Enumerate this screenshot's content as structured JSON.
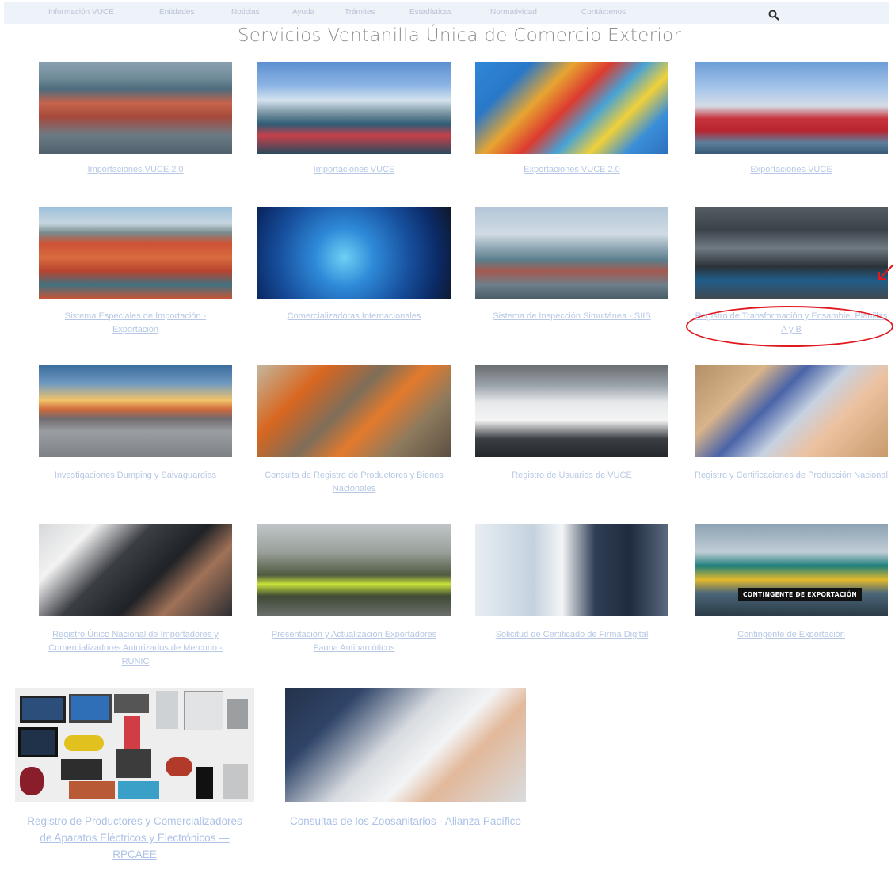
{
  "nav": {
    "items": [
      "Información VUCE",
      "Entidades",
      "Noticias",
      "Ayuda",
      "Trámites",
      "Estadísticas",
      "Normatividad",
      "Contáctenos"
    ]
  },
  "page": {
    "title": "Servicios Ventanilla Única de Comercio Exterior"
  },
  "services": [
    {
      "label": "Importaciones VUCE 2.0"
    },
    {
      "label": "Importaciones VUCE"
    },
    {
      "label": "Exportaciones VUCE 2.0"
    },
    {
      "label": "Exportaciones VUCE"
    },
    {
      "label": "Sistema Especiales de Importación - Exportación"
    },
    {
      "label": "Comercializadoras Internacionales"
    },
    {
      "label": "Sistema de Inspección Simultánea - SIIS"
    },
    {
      "label": "Registro de Transformación y Ensamble, Planillas A y B"
    },
    {
      "label": "Investigaciones Dumping y Salvaguardias"
    },
    {
      "label": "Consulta de Registro de Productores y Bienes Nacionales"
    },
    {
      "label": "Registro de Usuarios de VUCE"
    },
    {
      "label": "Registro y Certificaciones de Producción Nacional"
    },
    {
      "label": "Registro Único Nacional de Importadores y Comercializadores Autorizados de Mercurio - RUNIC"
    },
    {
      "label": "Presentación y Actualización Exportadores Fauna Antinarcóticos"
    },
    {
      "label": "Solicitud de Certificado de Firma Digital"
    },
    {
      "label": "Contingente de Exportación",
      "badge": "CONTINGENTE DE EXPORTACIÓN"
    },
    {
      "label": "Registro de Productores y Comercializadores de Aparatos Eléctricos y Electrónicos — RPCAEE"
    },
    {
      "label": "Consultas de los Zoosanitarios - Alianza Pacífico"
    }
  ],
  "icons": {
    "search": "search-icon"
  },
  "colors": {
    "link": "#b6c8e6",
    "annotation": "#e0191f",
    "nav_bg": "#eef2f9"
  }
}
